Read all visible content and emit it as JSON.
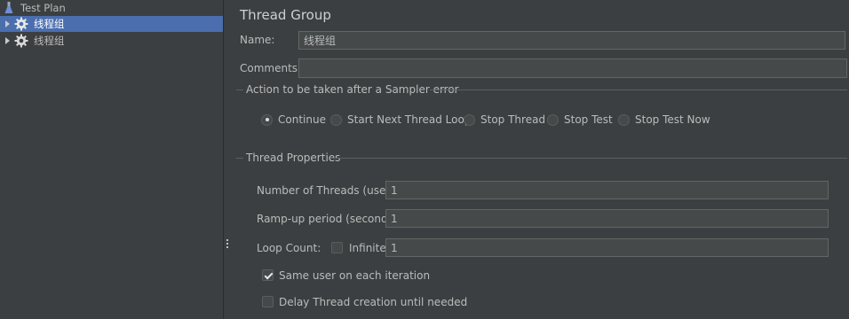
{
  "tree": {
    "items": [
      {
        "label": "Test Plan",
        "icon": "flask-icon"
      },
      {
        "label": "线程组",
        "icon": "gear-icon",
        "selected": true
      },
      {
        "label": "线程组",
        "icon": "gear-icon"
      }
    ]
  },
  "panel": {
    "title": "Thread Group",
    "name_label": "Name:",
    "name_value": "线程组",
    "comments_label": "Comments:",
    "comments_value": "",
    "error_group_title": "Action to be taken after a Sampler error",
    "error_actions": [
      {
        "label": "Continue",
        "selected": true
      },
      {
        "label": "Start Next Thread Loop",
        "selected": false
      },
      {
        "label": "Stop Thread",
        "selected": false
      },
      {
        "label": "Stop Test",
        "selected": false
      },
      {
        "label": "Stop Test Now",
        "selected": false
      }
    ],
    "props_group_title": "Thread Properties",
    "threads_label": "Number of Threads (users):",
    "threads_value": "1",
    "rampup_label": "Ramp-up period (seconds):",
    "rampup_value": "1",
    "loop_label": "Loop Count:",
    "infinite_label": "Infinite",
    "infinite_checked": false,
    "loop_value": "1",
    "same_user_label": "Same user on each iteration",
    "same_user_checked": true,
    "delay_label": "Delay Thread creation until needed",
    "delay_checked": false
  },
  "colors": {
    "background": "#3c3f41",
    "selection": "#4b6eaf",
    "field_bg": "#45494a",
    "text": "#bbbbbb"
  }
}
